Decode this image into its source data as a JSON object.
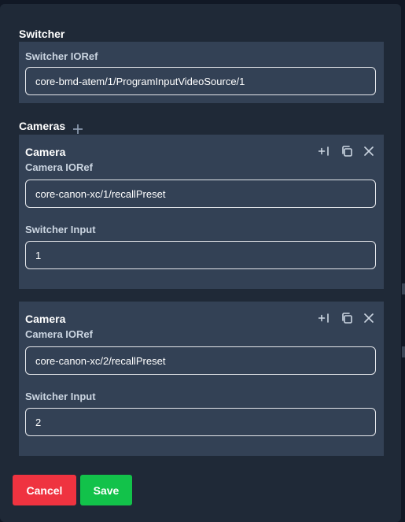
{
  "switcher": {
    "title": "Switcher",
    "ioref_label": "Switcher IORef",
    "ioref_value": "core-bmd-atem/1/ProgramInputVideoSource/1"
  },
  "cameras": {
    "title": "Cameras",
    "add_icon": "plus-icon",
    "items": [
      {
        "title": "Camera",
        "ioref_label": "Camera IORef",
        "ioref_value": "core-canon-xc/1/recallPreset",
        "input_label": "Switcher Input",
        "input_value": "1"
      },
      {
        "title": "Camera",
        "ioref_label": "Camera IORef",
        "ioref_value": "core-canon-xc/2/recallPreset",
        "input_label": "Switcher Input",
        "input_value": "2"
      }
    ],
    "card_icons": [
      "insert-icon",
      "copy-icon",
      "close-icon"
    ]
  },
  "footer": {
    "cancel_label": "Cancel",
    "save_label": "Save"
  },
  "colors": {
    "background": "#1f2937",
    "card": "#334155",
    "cancel": "#ef3340",
    "save": "#12c24a"
  }
}
